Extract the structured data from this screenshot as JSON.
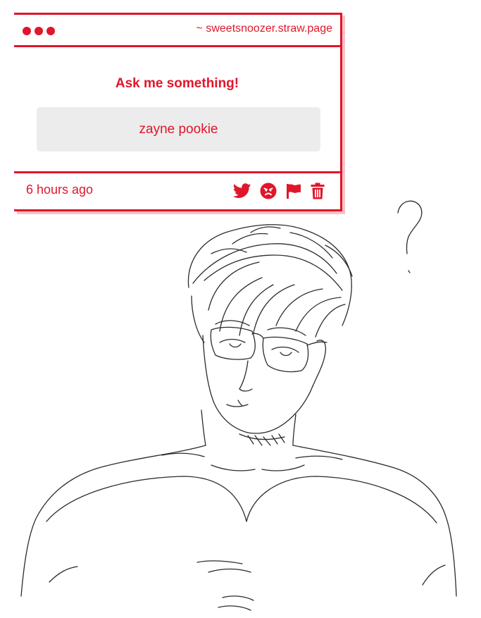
{
  "card": {
    "site": "~ sweetsnoozer.straw.page",
    "prompt": "Ask me something!",
    "answer": "zayne pookie",
    "timestamp": "6 hours ago",
    "actions": [
      "twitter-icon",
      "angry-face-icon",
      "flag-icon",
      "trash-icon"
    ]
  },
  "sketch": {
    "question_mark": "?"
  },
  "colors": {
    "accent": "#e0162b",
    "answer_bg": "#ececec",
    "shadow": "#f6c2c8"
  }
}
